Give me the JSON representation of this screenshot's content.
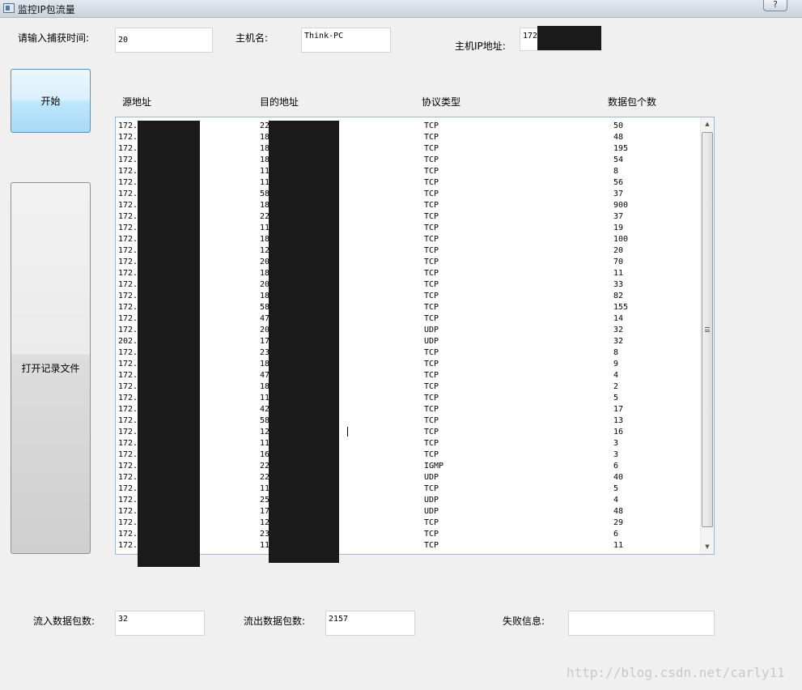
{
  "window": {
    "title": "监控IP包流量",
    "help_label": "?"
  },
  "capture": {
    "label": "请输入捕获时间:",
    "value": "20"
  },
  "host": {
    "name_label": "主机名:",
    "name_value": "Think-PC",
    "ip_label": "主机IP地址:",
    "ip_value": "172"
  },
  "buttons": {
    "start": "开始",
    "open_log": "打开记录文件"
  },
  "table": {
    "headers": [
      "源地址",
      "目的地址",
      "协议类型",
      "数据包个数"
    ],
    "rows": [
      [
        "172.",
        "22",
        "TCP",
        "50"
      ],
      [
        "172.",
        "18",
        "TCP",
        "48"
      ],
      [
        "172.",
        "18",
        "TCP",
        "195"
      ],
      [
        "172.",
        "18",
        "TCP",
        "54"
      ],
      [
        "172.",
        "11",
        "TCP",
        "8"
      ],
      [
        "172.",
        "11",
        "TCP",
        "56"
      ],
      [
        "172.",
        "58",
        "TCP",
        "37"
      ],
      [
        "172.",
        "18",
        "TCP",
        "900"
      ],
      [
        "172.",
        "22",
        "TCP",
        "37"
      ],
      [
        "172.",
        "11",
        "TCP",
        "19"
      ],
      [
        "172.",
        "18",
        "TCP",
        "100"
      ],
      [
        "172.",
        "12",
        "TCP",
        "20"
      ],
      [
        "172.",
        "20",
        "TCP",
        "70"
      ],
      [
        "172.",
        "18",
        "TCP",
        "11"
      ],
      [
        "172.",
        "20",
        "TCP",
        "33"
      ],
      [
        "172.",
        "18",
        "TCP",
        "82"
      ],
      [
        "172.",
        "58",
        "TCP",
        "155"
      ],
      [
        "172.",
        "47",
        "TCP",
        "14"
      ],
      [
        "172.",
        "20",
        "UDP",
        "32"
      ],
      [
        "202.",
        "17",
        "UDP",
        "32"
      ],
      [
        "172.",
        "23",
        "TCP",
        "8"
      ],
      [
        "172.",
        "18",
        "TCP",
        "9"
      ],
      [
        "172.",
        "47",
        "TCP",
        "4"
      ],
      [
        "172.",
        "18",
        "TCP",
        "2"
      ],
      [
        "172.",
        "11",
        "TCP",
        "5"
      ],
      [
        "172.",
        "42",
        "TCP",
        "17"
      ],
      [
        "172.",
        "58",
        "TCP",
        "13"
      ],
      [
        "172.",
        "12",
        "TCP",
        "16"
      ],
      [
        "172.",
        "11",
        "TCP",
        "3"
      ],
      [
        "172.",
        "16",
        "TCP",
        "3"
      ],
      [
        "172.",
        "22",
        "IGMP",
        "6"
      ],
      [
        "172.",
        "22",
        "UDP",
        "40"
      ],
      [
        "172.",
        "11",
        "TCP",
        "5"
      ],
      [
        "172.",
        "25",
        "UDP",
        "4"
      ],
      [
        "172.",
        "17",
        "UDP",
        "48"
      ],
      [
        "172.",
        "12",
        "TCP",
        "29"
      ],
      [
        "172.",
        "23",
        "TCP",
        "6"
      ],
      [
        "172.",
        "11",
        "TCP",
        "11"
      ]
    ]
  },
  "stats": {
    "in_label": "流入数据包数:",
    "in_value": "32",
    "out_label": "流出数据包数:",
    "out_value": "2157",
    "error_label": "失败信息:",
    "error_value": ""
  },
  "watermark": "http://blog.csdn.net/carly11"
}
